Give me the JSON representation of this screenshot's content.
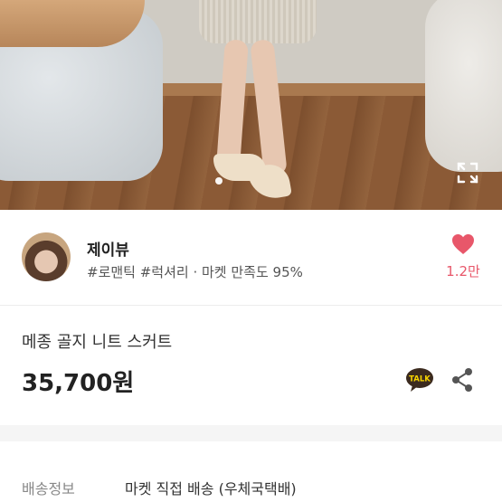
{
  "seller": {
    "name": "제이뷰",
    "meta": "#로맨틱 #럭셔리 · 마켓 만족도 95%",
    "likes": "1.2만"
  },
  "product": {
    "title": "메종 골지 니트 스커트",
    "price": "35,700원"
  },
  "shipping": {
    "label": "배송정보",
    "value": "마켓 직접 배송 (우체국택배)"
  },
  "icons": {
    "expand": "expand-icon",
    "heart": "heart-icon",
    "talk": "talk-icon",
    "share": "share-icon",
    "talk_text": "TALK"
  },
  "colors": {
    "heart": "#e8576a",
    "talk_bubble": "#3b2a1e"
  }
}
